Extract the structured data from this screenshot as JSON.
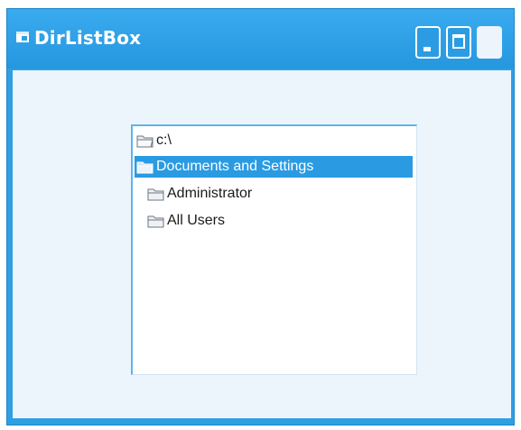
{
  "window": {
    "title": "DirListBox",
    "accent_color": "#2f9fe3"
  },
  "titlebar_buttons": {
    "minimize": "minimize-icon",
    "maximize": "maximize-icon",
    "close": "close-icon"
  },
  "dirlist": {
    "items": [
      {
        "label": "c:\\",
        "icon": "open-folder-icon",
        "selected": false
      },
      {
        "label": "Documents and Settings",
        "icon": "open-folder-icon",
        "selected": true
      },
      {
        "label": "Administrator",
        "icon": "folder-icon",
        "selected": false
      },
      {
        "label": "All Users",
        "icon": "folder-icon",
        "selected": false
      }
    ],
    "selection_color": "#2a9be2"
  }
}
